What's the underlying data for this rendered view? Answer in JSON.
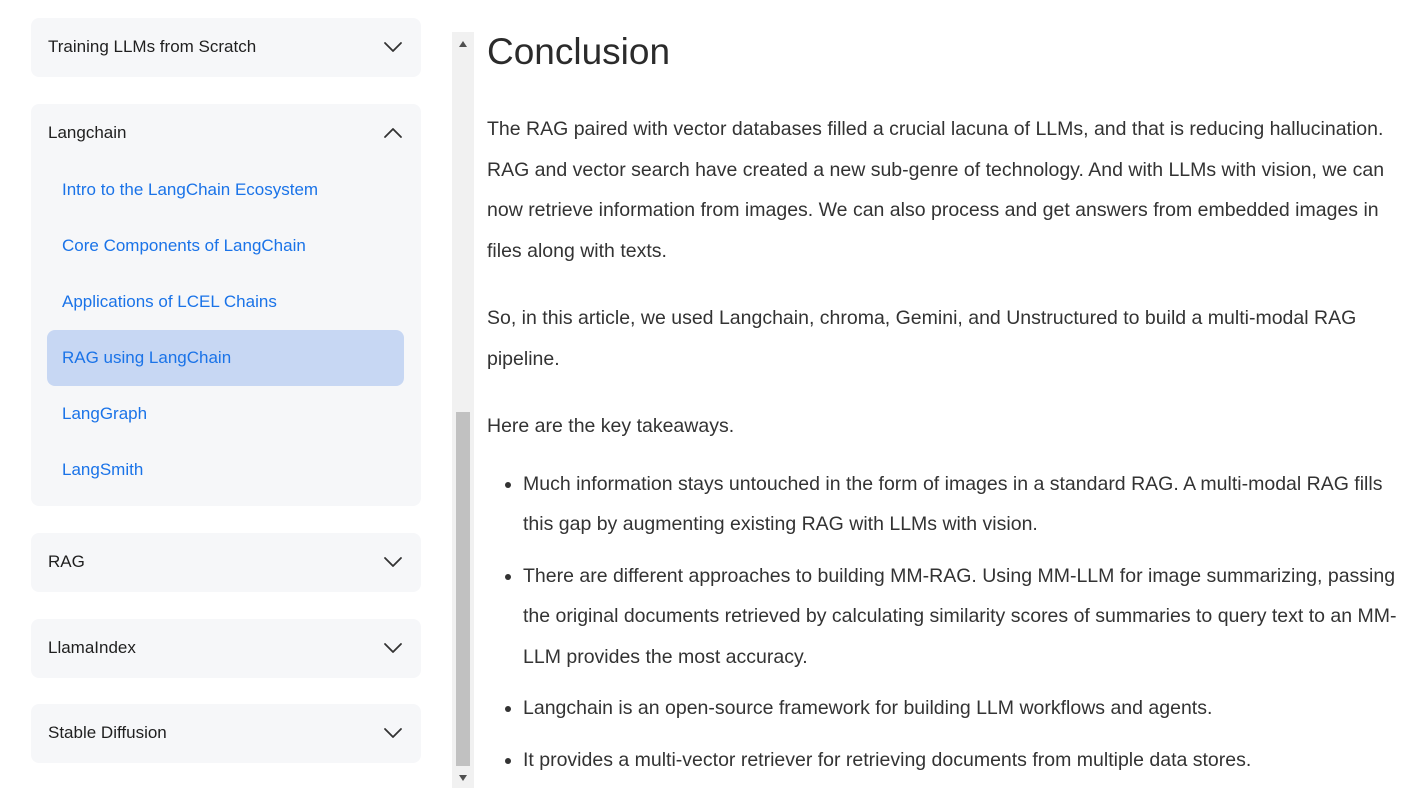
{
  "sidebar": {
    "sections": [
      {
        "title": "Training LLMs from Scratch",
        "expanded": false,
        "icon": "chevron-down-icon"
      },
      {
        "title": "Langchain",
        "expanded": true,
        "icon": "chevron-up-icon",
        "items": [
          {
            "label": "Intro to the LangChain Ecosystem",
            "active": false
          },
          {
            "label": "Core Components of LangChain",
            "active": false
          },
          {
            "label": "Applications of LCEL Chains",
            "active": false
          },
          {
            "label": "RAG using LangChain",
            "active": true
          },
          {
            "label": "LangGraph",
            "active": false
          },
          {
            "label": "LangSmith",
            "active": false
          }
        ]
      },
      {
        "title": "RAG",
        "expanded": false,
        "icon": "chevron-down-icon"
      },
      {
        "title": "LlamaIndex",
        "expanded": false,
        "icon": "chevron-down-icon"
      },
      {
        "title": "Stable Diffusion",
        "expanded": false,
        "icon": "chevron-down-icon"
      }
    ]
  },
  "article": {
    "heading": "Conclusion",
    "paragraphs": [
      "The RAG paired with vector databases filled a crucial lacuna of LLMs, and that is reducing hallucination. RAG and vector search have created a new sub-genre of technology. And with LLMs with vision, we can now retrieve information from images. We can also process and get answers from embedded images in files along with texts.",
      "So, in this article, we used Langchain, chroma, Gemini, and Unstructured to build a multi-modal RAG pipeline.",
      "Here are the key takeaways."
    ],
    "takeaways": [
      "Much information stays untouched in the form of images in a standard RAG. A multi-modal RAG fills this gap by augmenting existing RAG with LLMs with vision.",
      "There are different approaches to building MM-RAG. Using MM-LLM for image summarizing, passing the original documents retrieved by calculating similarity scores of summaries to query text to an MM-LLM provides the most accuracy.",
      "Langchain is an open-source framework for building LLM workflows and agents.",
      "It provides a multi-vector retriever for retrieving documents from multiple data stores."
    ]
  },
  "colors": {
    "link": "#1a73e8",
    "active_bg": "#c7d7f3",
    "card_bg": "#f6f7f9",
    "scroll_thumb": "#c1c1c1"
  }
}
